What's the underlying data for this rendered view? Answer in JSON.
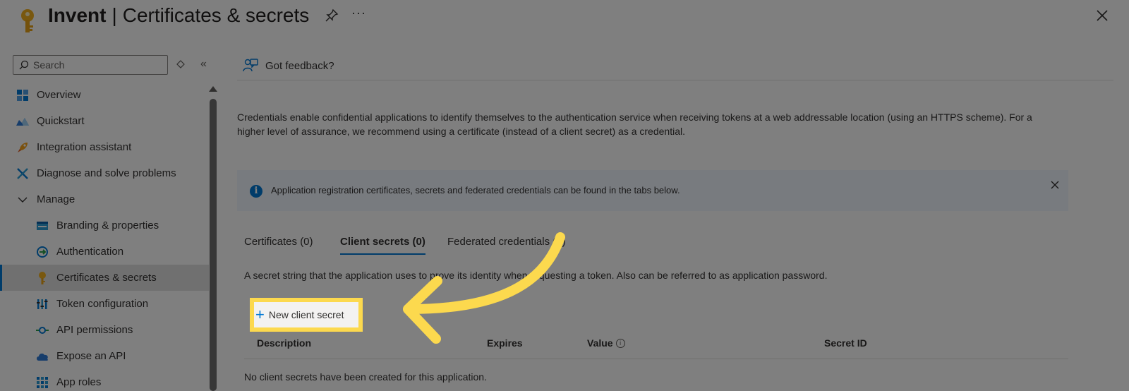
{
  "header": {
    "app_name": "Invent",
    "page_title": "Certificates & secrets",
    "pin_icon": "pin-icon",
    "more_label": "···",
    "close_icon": "close-icon"
  },
  "sidebar": {
    "search_placeholder": "Search",
    "collapse_label": "«",
    "items": [
      {
        "label": "Overview",
        "icon": "overview-icon",
        "level": 0
      },
      {
        "label": "Quickstart",
        "icon": "quickstart-icon",
        "level": 0
      },
      {
        "label": "Integration assistant",
        "icon": "rocket-icon",
        "level": 0
      },
      {
        "label": "Diagnose and solve problems",
        "icon": "wrench-icon",
        "level": 0
      },
      {
        "label": "Manage",
        "icon": "chevron-down-icon",
        "level": 0
      },
      {
        "label": "Branding & properties",
        "icon": "branding-icon",
        "level": 1
      },
      {
        "label": "Authentication",
        "icon": "authentication-icon",
        "level": 1
      },
      {
        "label": "Certificates & secrets",
        "icon": "key-icon",
        "level": 1,
        "active": true
      },
      {
        "label": "Token configuration",
        "icon": "token-icon",
        "level": 1
      },
      {
        "label": "API permissions",
        "icon": "api-permissions-icon",
        "level": 1
      },
      {
        "label": "Expose an API",
        "icon": "cloud-icon",
        "level": 1
      },
      {
        "label": "App roles",
        "icon": "app-roles-icon",
        "level": 1
      }
    ]
  },
  "command_bar": {
    "feedback_label": "Got feedback?"
  },
  "main": {
    "intro": "Credentials enable confidential applications to identify themselves to the authentication service when receiving tokens at a web addressable location (using an HTTPS scheme). For a higher level of assurance, we recommend using a certificate (instead of a client secret) as a credential.",
    "banner_info": "i",
    "banner_text": "Application registration certificates, secrets and federated credentials can be found in the tabs below.",
    "tabs": [
      {
        "label": "Certificates (0)"
      },
      {
        "label": "Client secrets (0)",
        "selected": true
      },
      {
        "label": "Federated credentials (0)"
      }
    ],
    "secret_description": "A secret string that the application uses to prove its identity when requesting a token. Also can be referred to as application password.",
    "new_secret_button": "New client secret",
    "new_secret_plus": "+",
    "table": {
      "columns": [
        "Description",
        "Expires",
        "Value",
        "Secret ID"
      ],
      "value_info": "i",
      "empty_text": "No client secrets have been created for this application."
    }
  },
  "colors": {
    "accent": "#0078d4",
    "highlight": "#fcd94e",
    "key_gold": "#e8a317"
  }
}
